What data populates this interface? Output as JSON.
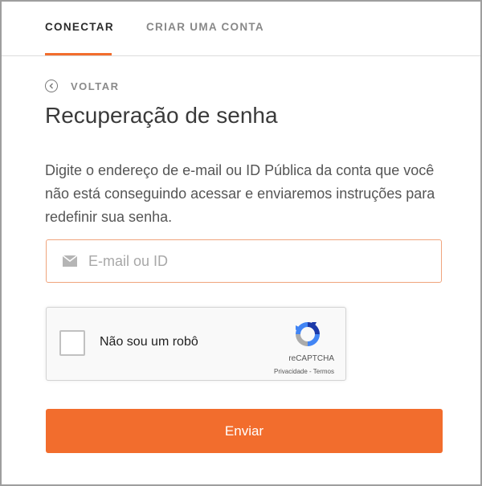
{
  "tabs": {
    "login": "CONECTAR",
    "signup": "CRIAR UMA CONTA"
  },
  "back": {
    "label": "VOLTAR"
  },
  "page": {
    "title": "Recuperação de senha",
    "description": "Digite o endereço de e-mail ou ID Pública da conta que você não está conseguindo acessar e enviaremos instruções para redefinir sua senha."
  },
  "email": {
    "placeholder": "E-mail ou ID",
    "value": ""
  },
  "captcha": {
    "label": "Não sou um robô",
    "brand": "reCAPTCHA",
    "privacy": "Privacidade",
    "separator": " - ",
    "terms": "Termos"
  },
  "submit": {
    "label": "Enviar"
  },
  "colors": {
    "accent": "#f26d2d",
    "input_border": "#f0a47d",
    "text": "#3a3a3a"
  },
  "icons": {
    "back": "circle-chevron-left-icon",
    "email": "envelope-icon",
    "recaptcha": "recaptcha-logo-icon"
  }
}
